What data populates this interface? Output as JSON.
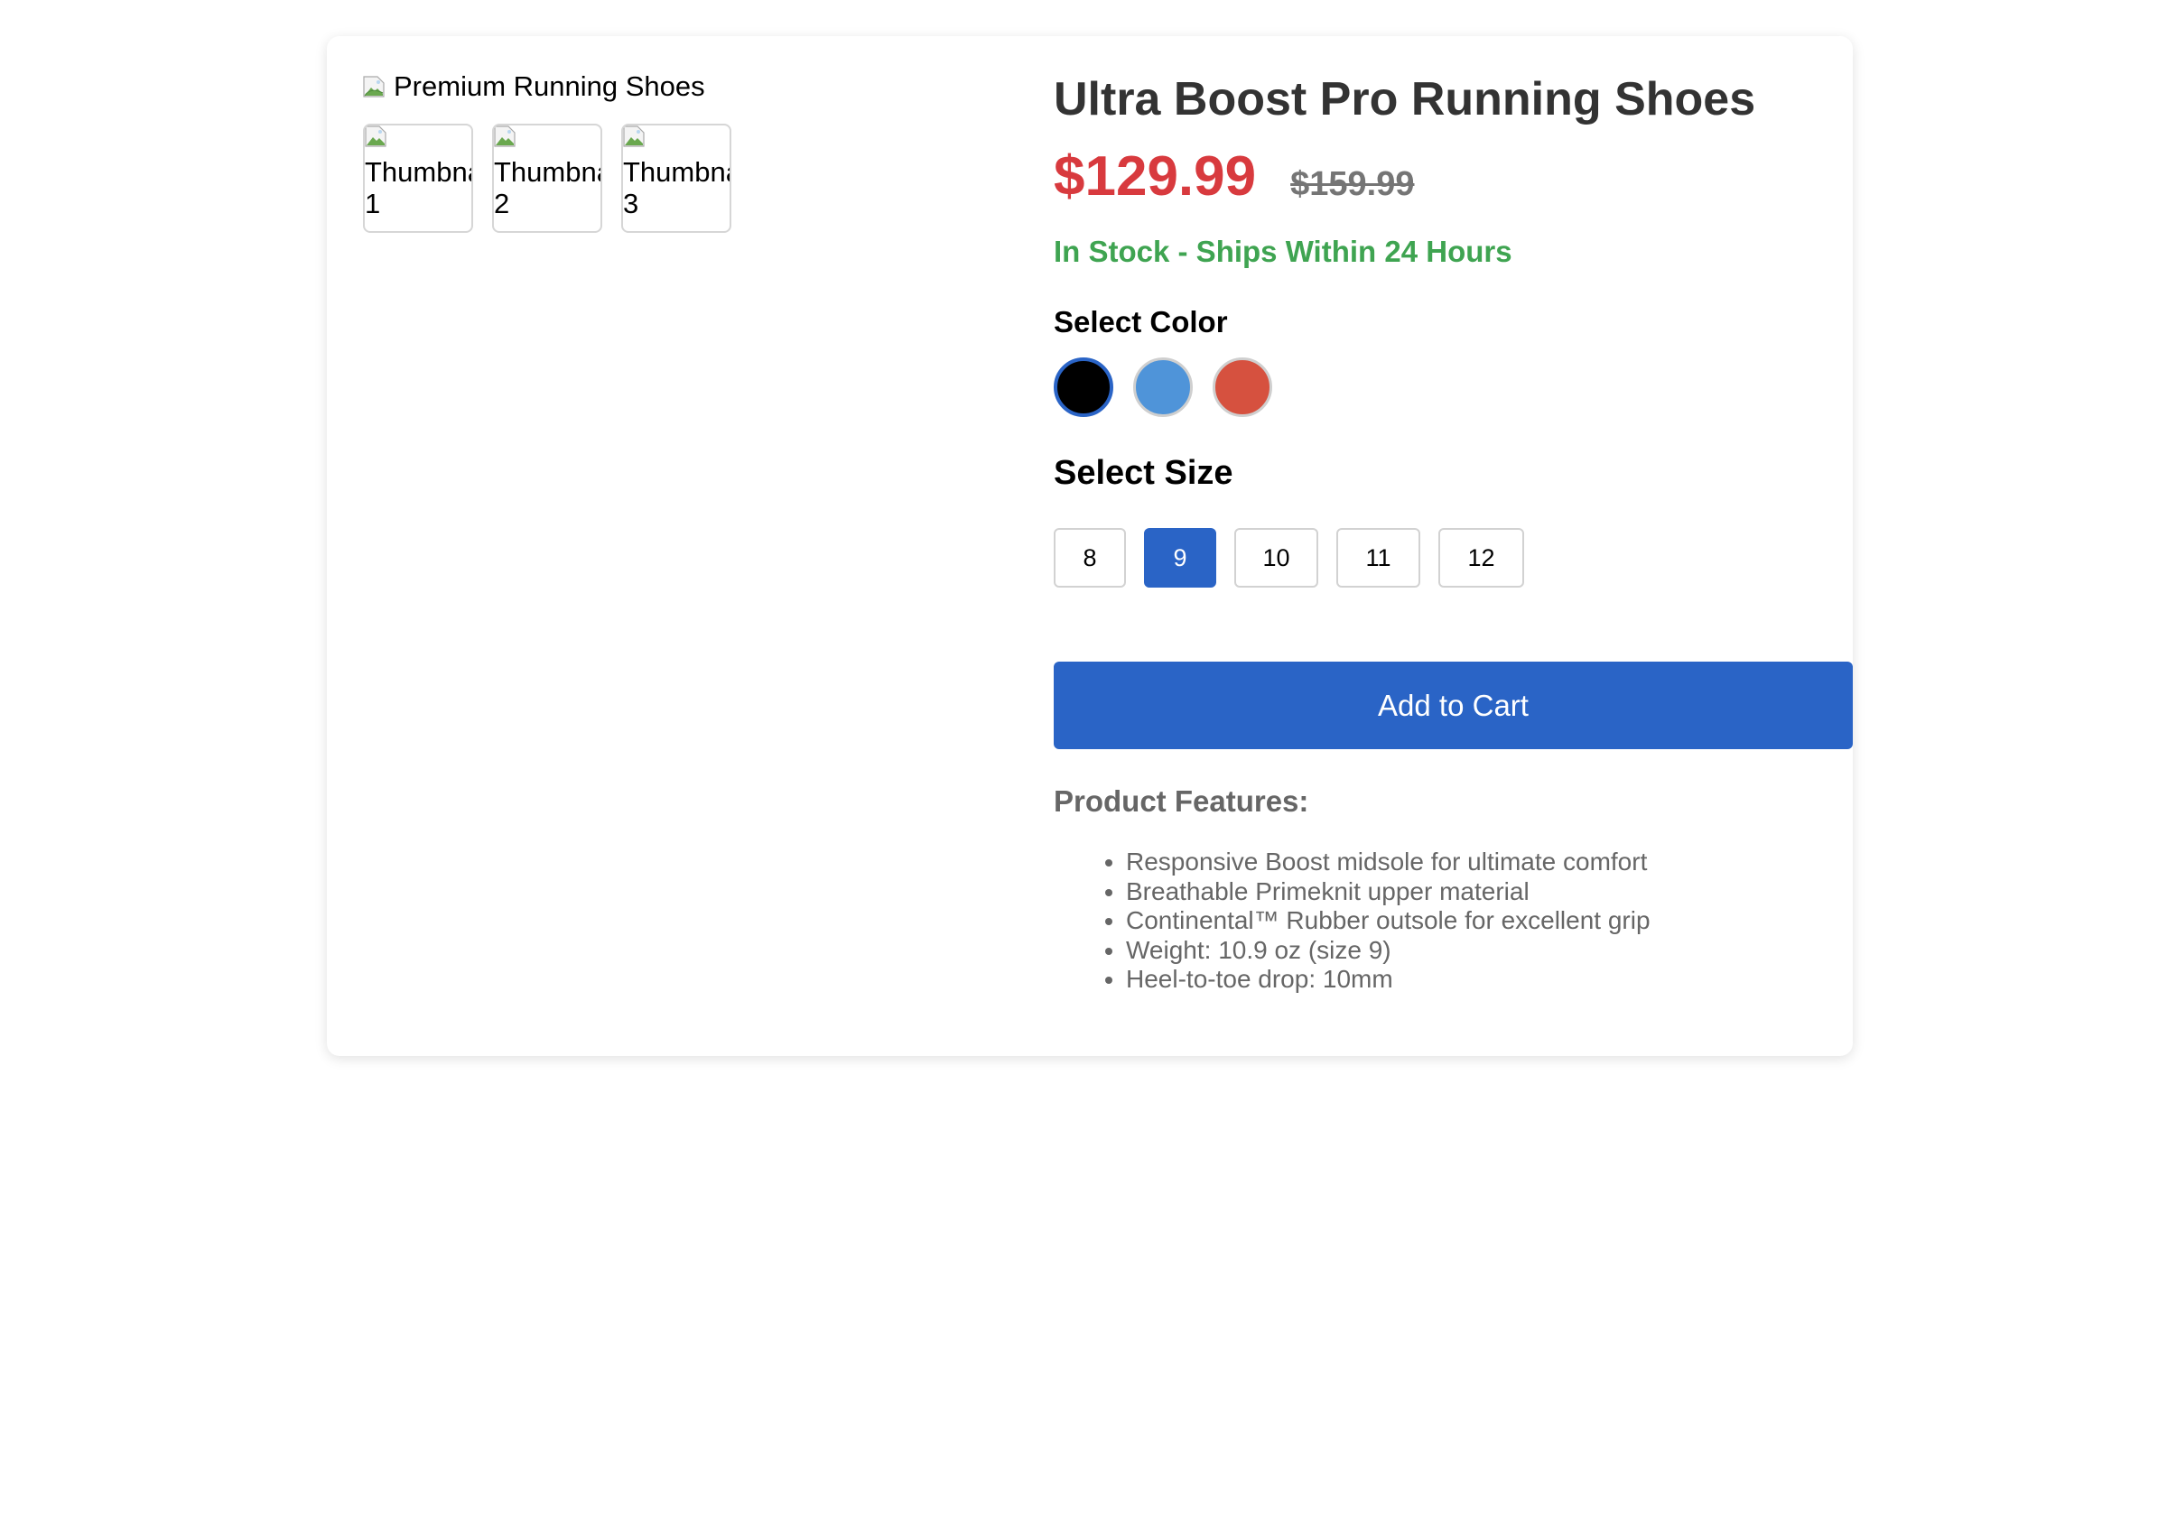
{
  "gallery": {
    "main_image_alt": "Premium Running Shoes",
    "thumbnails": [
      {
        "alt_line1": "Thumbnail",
        "alt_line2": "1"
      },
      {
        "alt_line1": "Thumbnail",
        "alt_line2": "2"
      },
      {
        "alt_line1": "Thumbnail",
        "alt_line2": "3"
      }
    ]
  },
  "product": {
    "title": "Ultra Boost Pro Running Shoes",
    "price": "$129.99",
    "original_price": "$159.99",
    "stock_status": "In Stock - Ships Within 24 Hours"
  },
  "color_selector": {
    "label": "Select Color",
    "options": [
      {
        "name": "black",
        "hex": "#000000",
        "selected": true
      },
      {
        "name": "blue",
        "hex": "#4f94d9",
        "selected": false
      },
      {
        "name": "red",
        "hex": "#d6513f",
        "selected": false
      }
    ]
  },
  "size_selector": {
    "label": "Select Size",
    "options": [
      "8",
      "9",
      "10",
      "11",
      "12"
    ],
    "selected": "9"
  },
  "cart": {
    "add_label": "Add to Cart"
  },
  "features": {
    "title": "Product Features:",
    "items": [
      "Responsive Boost midsole for ultimate comfort",
      "Breathable Primeknit upper material",
      "Continental™ Rubber outsole for excellent grip",
      "Weight: 10.9 oz (size 9)",
      "Heel-to-toe drop: 10mm"
    ]
  },
  "colors": {
    "accent": "#2a64c6",
    "sale_price": "#d83a3e",
    "in_stock": "#3fa451",
    "muted_text": "#666666"
  }
}
